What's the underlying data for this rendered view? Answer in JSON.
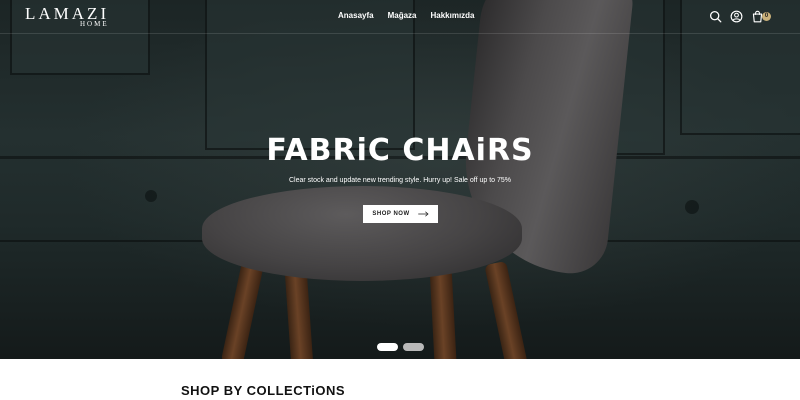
{
  "brand": {
    "logo_main": "LAMAZI",
    "logo_sub": "HOME"
  },
  "nav": {
    "items": [
      "Anasayfa",
      "Mağaza",
      "Hakkımızda"
    ]
  },
  "header_icons": [
    "search-icon",
    "user-icon",
    "cart-icon"
  ],
  "cart": {
    "count": "0"
  },
  "hero": {
    "title": "FABRiC CHAiRS",
    "subtitle": "Clear stock and update new trending style. Hurry up! Sale off up to 75%",
    "cta_label": "SHOP NOW"
  },
  "slider": {
    "total_slides": 2,
    "active_slide": 1
  },
  "section": {
    "title": "SHOP BY COLLECTiONS"
  },
  "colors": {
    "hero_bg": "#243030",
    "badge": "#c9b07a",
    "chair_fabric": "#4c4a4b",
    "chair_legs": "#6a4226"
  }
}
